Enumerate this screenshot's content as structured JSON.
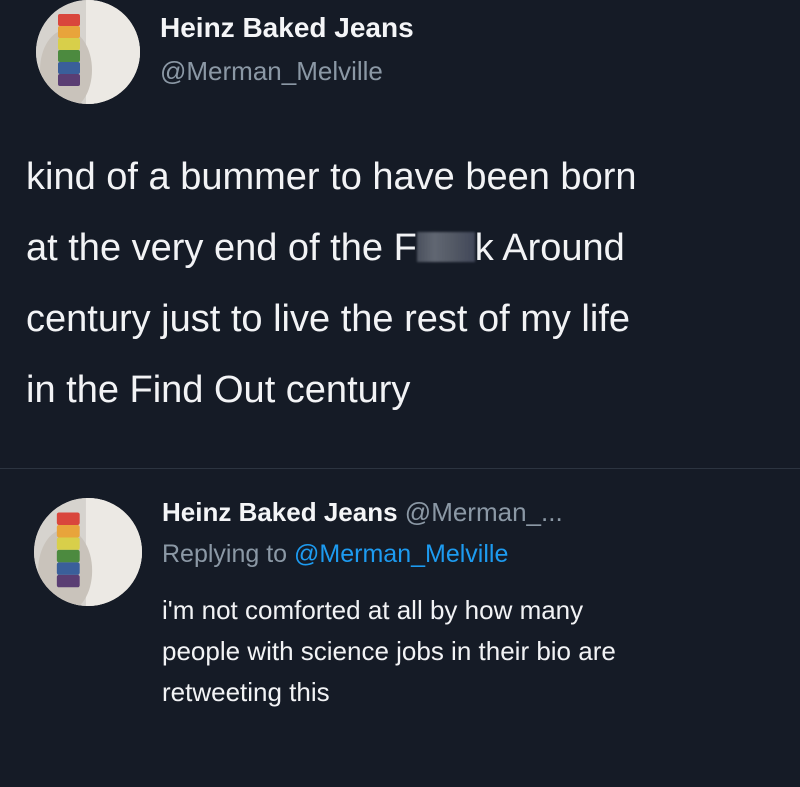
{
  "main_tweet": {
    "display_name": "Heinz Baked Jeans",
    "handle": "@Merman_Melville",
    "avatar_icon": "avatar-profile-image",
    "text_lines": [
      "kind of a bummer to have been born",
      "at the very end of the F",
      "k Around",
      "century just to live the rest of my life",
      "in the Find Out century"
    ]
  },
  "reply_tweet": {
    "display_name": "Heinz Baked Jeans",
    "handle": "@Merman_...",
    "avatar_icon": "avatar-profile-image",
    "replying_prefix": "Replying to",
    "replying_to": "@Merman_Melville",
    "text_lines": [
      "i'm not comforted at all by how many",
      "people with science jobs in their bio are",
      "retweeting this"
    ]
  },
  "colors": {
    "background": "#151b26",
    "primary_text": "#f2f3f5",
    "secondary_text": "#8b98a5",
    "link": "#1d9bf0",
    "divider": "#2c3440"
  }
}
